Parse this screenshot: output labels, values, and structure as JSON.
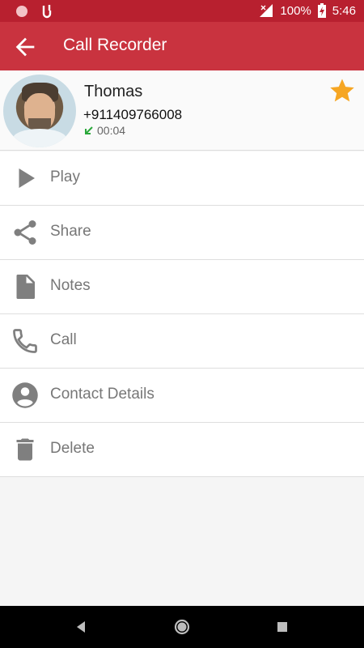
{
  "status_bar": {
    "battery": "100%",
    "time": "5:46",
    "icons": [
      "record-indicator-icon",
      "app-notification-icon",
      "no-signal-icon",
      "battery-charging-icon"
    ]
  },
  "app_bar": {
    "title": "Call Recorder",
    "back_icon": "arrow-back-icon"
  },
  "contact": {
    "name": "Thomas",
    "number": "+911409766008",
    "duration": "00:04",
    "call_direction_icon": "incoming-call-arrow-icon",
    "favorite": true
  },
  "menu": {
    "items": [
      {
        "label": "Play",
        "icon": "play-icon"
      },
      {
        "label": "Share",
        "icon": "share-icon"
      },
      {
        "label": "Notes",
        "icon": "notes-icon"
      },
      {
        "label": "Call",
        "icon": "phone-icon"
      },
      {
        "label": "Contact Details",
        "icon": "contact-icon"
      },
      {
        "label": "Delete",
        "icon": "delete-icon"
      }
    ]
  },
  "colors": {
    "status_bar": "#b8202f",
    "app_bar": "#c9333f",
    "star": "#f6a623",
    "icon": "#7f7f7f",
    "incoming_arrow": "#2aa83a"
  }
}
